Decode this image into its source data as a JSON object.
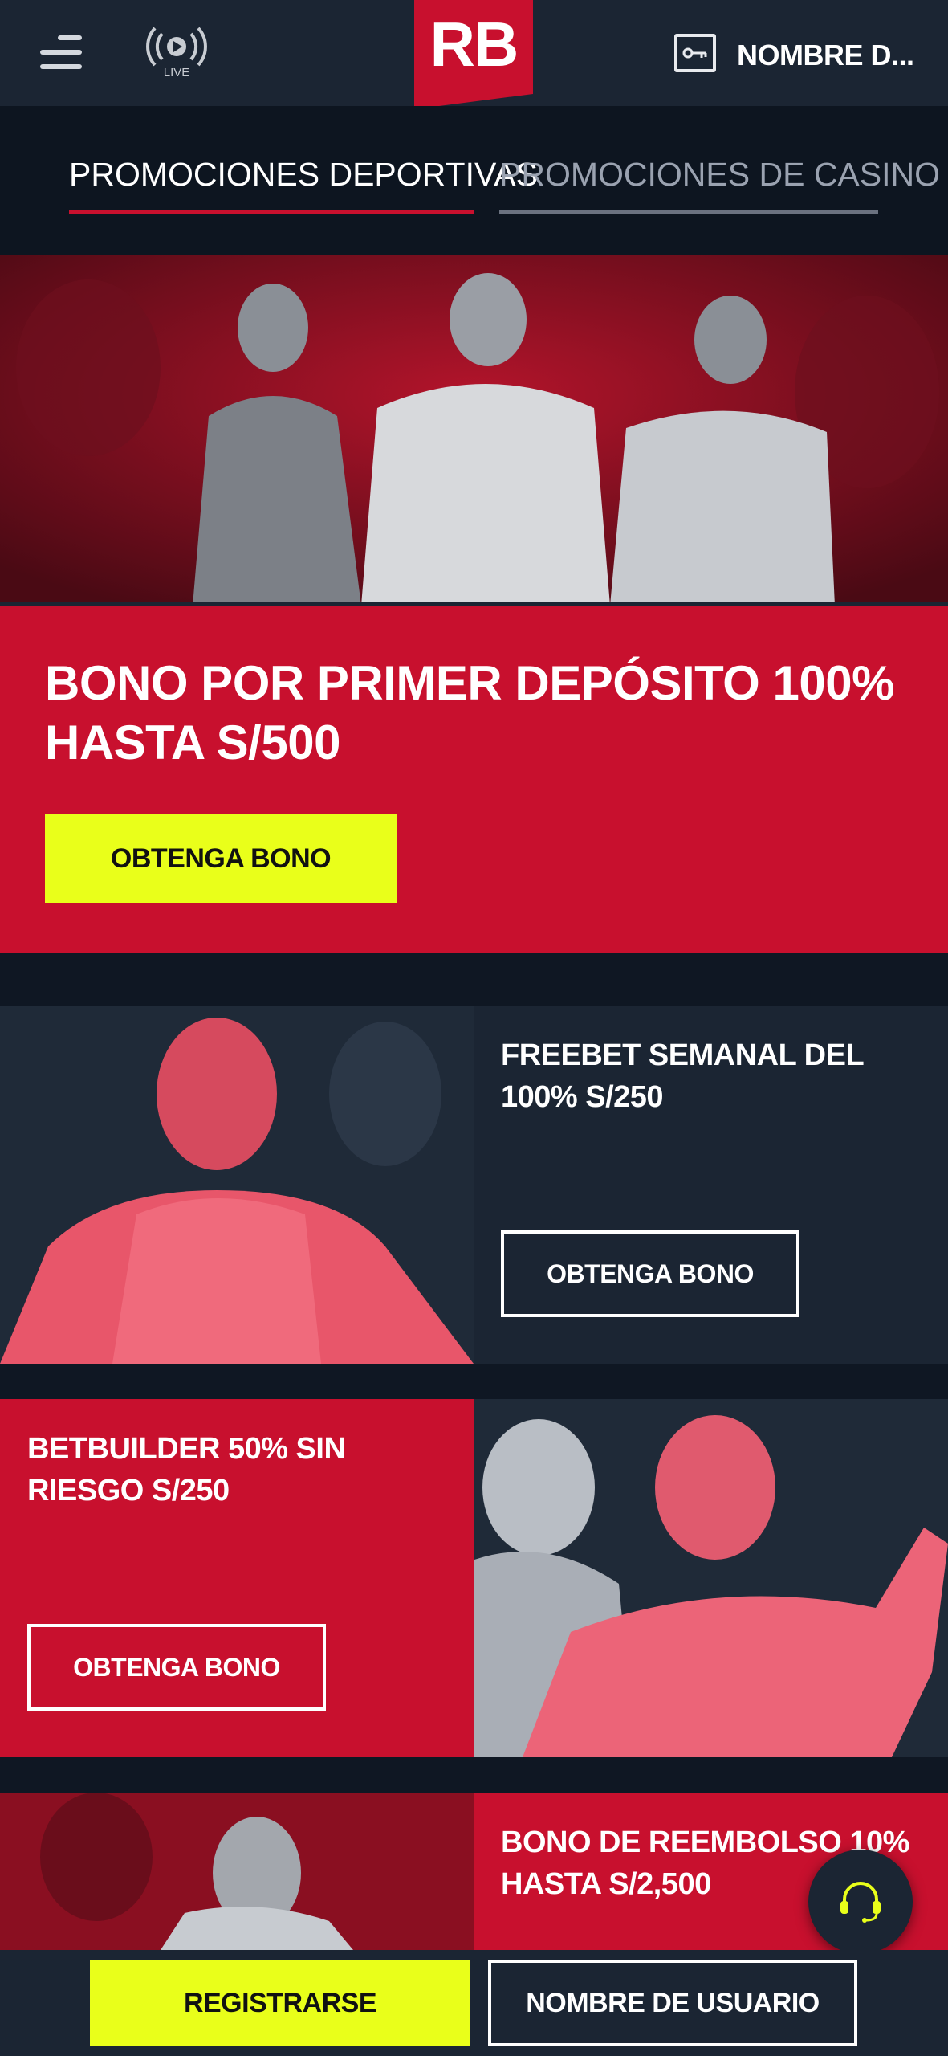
{
  "header": {
    "live_label": "LIVE",
    "logo_text": "RB",
    "user_label": "NOMBRE D..."
  },
  "tabs": [
    {
      "label": "PROMOCIONES DEPORTIVAS",
      "active": true
    },
    {
      "label": "PROMOCIONES DE CASINO",
      "active": false
    }
  ],
  "hero": {
    "title": "BONO POR PRIMER DEPÓSITO 100% HASTA S/500",
    "button": "OBTENGA BONO"
  },
  "promos": [
    {
      "title": "FREEBET SEMANAL DEL 100% S/250",
      "button": "OBTENGA BONO"
    },
    {
      "title": "BETBUILDER 50% SIN RIESGO S/250",
      "button": "OBTENGA BONO"
    },
    {
      "title": "BONO DE REEMBOLSO 10% HASTA S/2,500"
    }
  ],
  "bottom_bar": {
    "register": "REGISTRARSE",
    "login": "NOMBRE DE USUARIO"
  },
  "colors": {
    "brand_red": "#c8102e",
    "navy": "#1b2533",
    "dark_bg": "#0f1723",
    "accent_yellow": "#e9ff1a"
  },
  "icons": [
    "menu-icon",
    "live-stream-icon",
    "login-key-icon",
    "headset-icon"
  ]
}
